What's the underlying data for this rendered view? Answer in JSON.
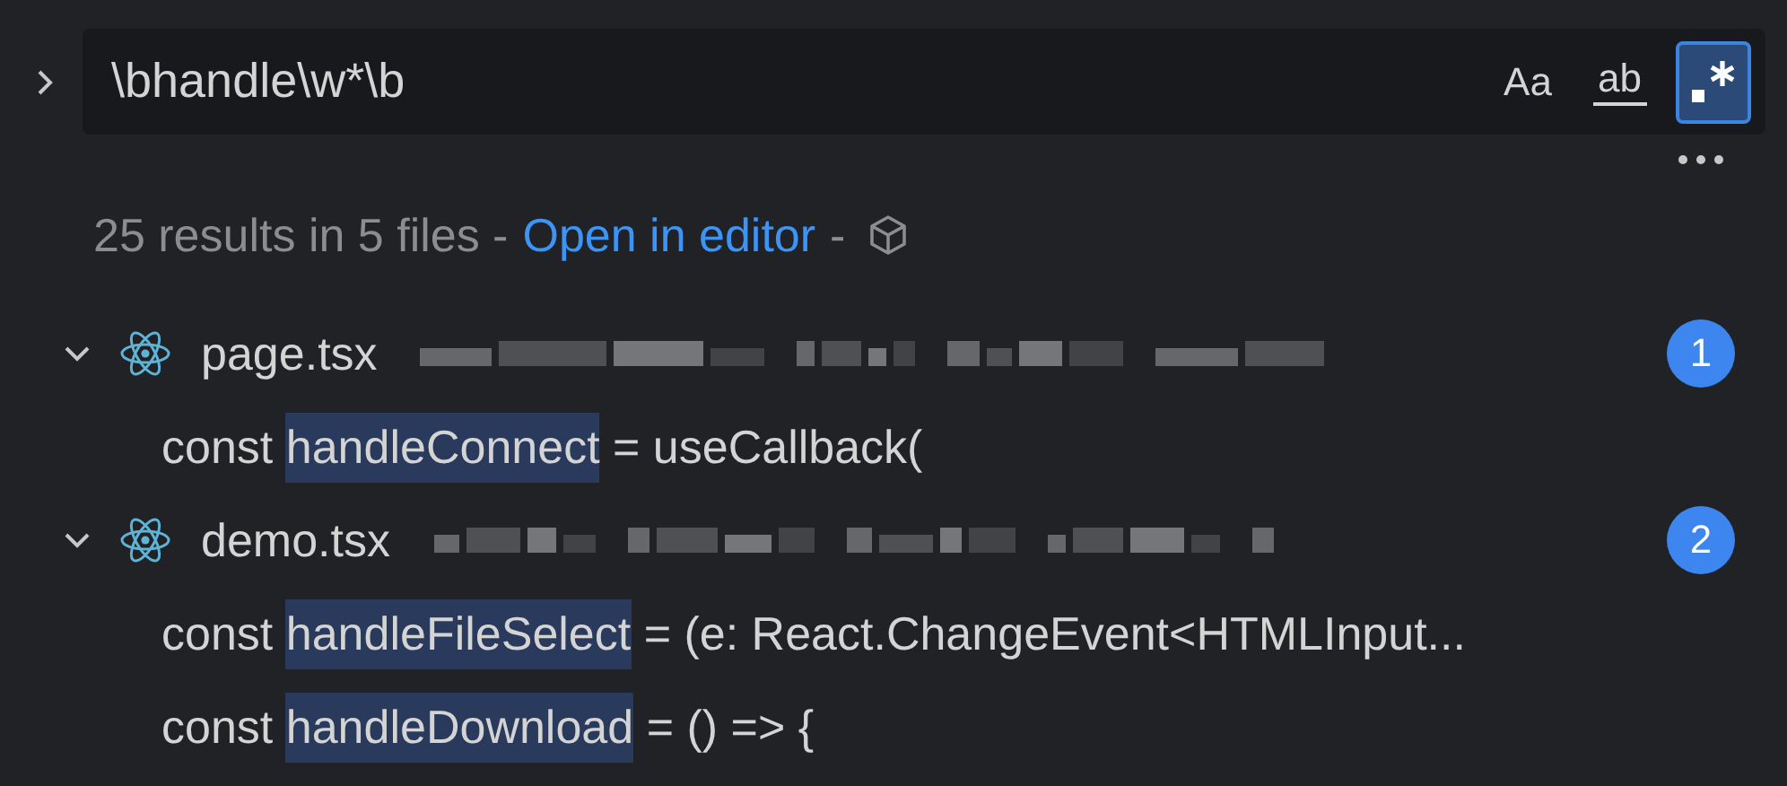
{
  "search": {
    "query": "\\bhandle\\w*\\b",
    "expanded": false,
    "toggles": [
      {
        "kind": "text",
        "label": "Aa",
        "selected": false
      },
      {
        "kind": "underlined",
        "label": "ab",
        "selected": false
      },
      {
        "kind": "regex",
        "selected": true
      }
    ]
  },
  "summary": {
    "text": "25 results in 5 files -",
    "link": "Open in editor",
    "after": "-"
  },
  "files": [
    {
      "name": "page.tsx",
      "expanded": true,
      "count": "1",
      "matches": [
        {
          "before": "const ",
          "match": "handleConnect",
          "after": " = useCallback("
        }
      ]
    },
    {
      "name": "demo.tsx",
      "expanded": true,
      "count": "2",
      "matches": [
        {
          "before": "const ",
          "match": "handleFileSelect",
          "after": " = (e: React.ChangeEvent<HTMLInput..."
        },
        {
          "before": "const ",
          "match": "handleDownload",
          "after": " = () => {"
        }
      ]
    }
  ]
}
